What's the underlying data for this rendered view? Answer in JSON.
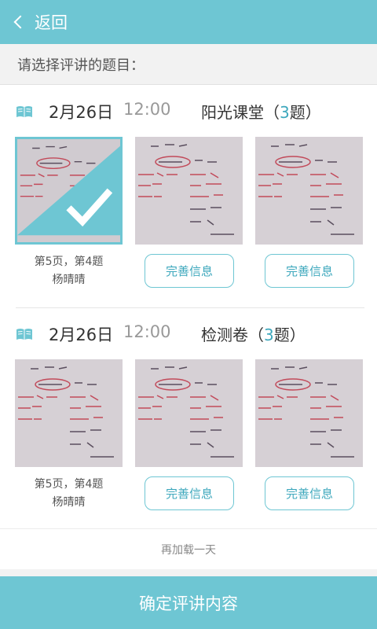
{
  "header": {
    "back_label": "返回"
  },
  "prompt": "请选择评讲的题目：",
  "sections": [
    {
      "date": "2月26日",
      "time": "12:00",
      "subject": "阳光课堂",
      "count": "3",
      "count_suffix": "题",
      "open_paren": "（",
      "close_paren": "）",
      "first_caption_line1": "第5页，第4题",
      "first_caption_line2": "杨晴晴",
      "button_label": "完善信息"
    },
    {
      "date": "2月26日",
      "time": "12:00",
      "subject": "检测卷",
      "count": "3",
      "count_suffix": "题",
      "open_paren": "（",
      "close_paren": "）",
      "first_caption_line1": "第5页，第4题",
      "first_caption_line2": "杨晴晴",
      "button_label": "完善信息"
    }
  ],
  "load_more": "再加载一天",
  "confirm_label": "确定评讲内容",
  "colors": {
    "accent": "#6ec6d3",
    "accent_text": "#3ea8bd"
  }
}
